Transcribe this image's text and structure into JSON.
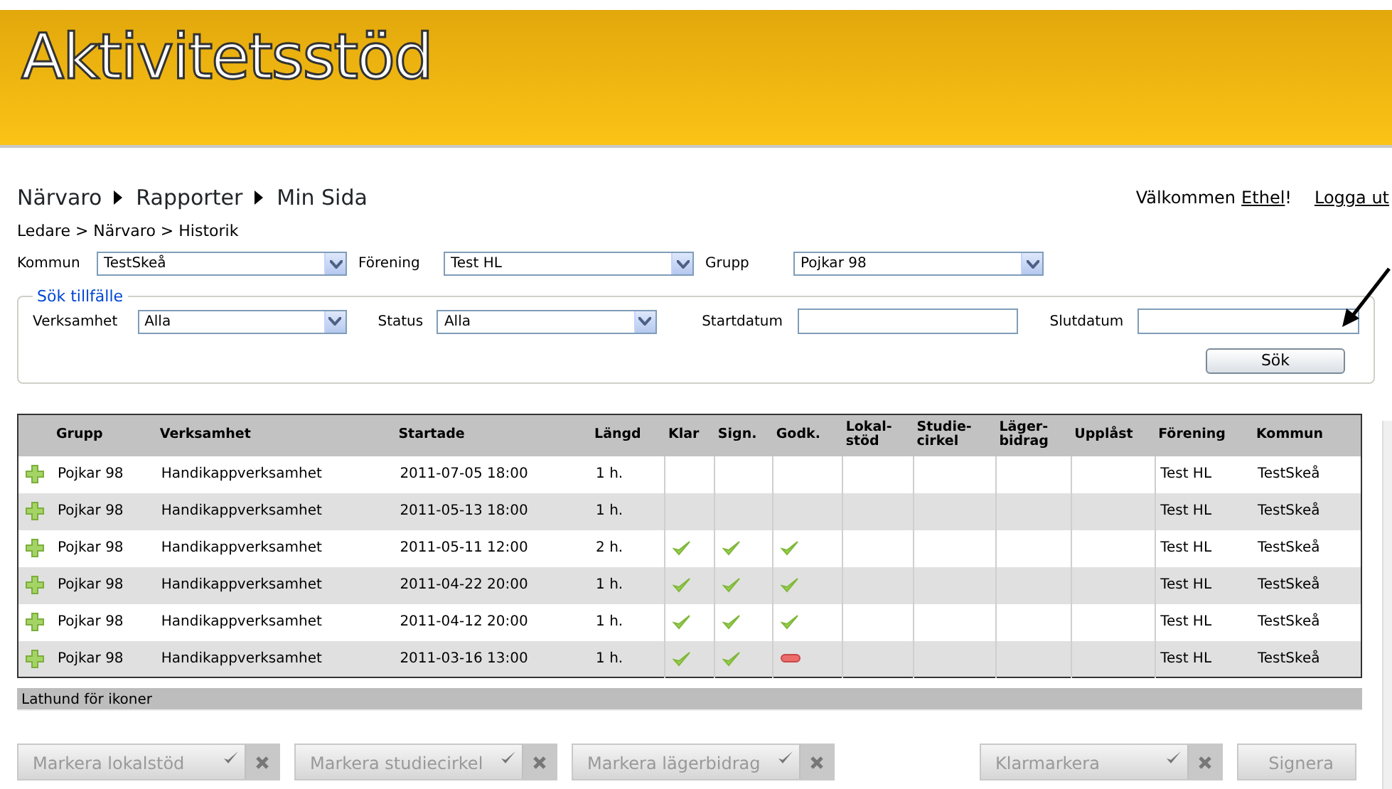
{
  "header": {
    "logo": "Aktivitetsstöd"
  },
  "nav": {
    "items": [
      "Närvaro",
      "Rapporter",
      "Min Sida"
    ],
    "welcome": "Välkommen",
    "user": "Ethel",
    "welcome_end": "!",
    "logout": "Logga ut"
  },
  "breadcrumb": "Ledare > Närvaro > Historik",
  "filters": [
    {
      "label": "Kommun",
      "value": "TestSkeå"
    },
    {
      "label": "Förening",
      "value": "Test HL"
    },
    {
      "label": "Grupp",
      "value": "Pojkar 98"
    }
  ],
  "search": {
    "legend": "Sök tillfälle",
    "fields": [
      {
        "kind": "select",
        "label": "Verksamhet",
        "value": "Alla"
      },
      {
        "kind": "select",
        "label": "Status",
        "value": "Alla"
      },
      {
        "kind": "text",
        "label": "Startdatum"
      },
      {
        "kind": "text",
        "label": "Slutdatum"
      }
    ],
    "button": "Sök"
  },
  "table": {
    "columns": [
      "Grupp",
      "Verksamhet",
      "Startade",
      "Längd",
      "Klar",
      "Sign.",
      "Godk.",
      "Lokal-\nstöd",
      "Studie-\ncirkel",
      "Läger-\nbidrag",
      "Upplåst",
      "Förening",
      "Kommun"
    ],
    "rows": [
      {
        "grupp": "Pojkar 98",
        "verksamhet": "Handikappverksamhet",
        "startade": "2011-07-05 18:00",
        "langd": "1 h.",
        "klar": false,
        "signerad": false,
        "godkand": false,
        "nekad": false,
        "forening": "Test HL",
        "kommun": "TestSkeå"
      },
      {
        "grupp": "Pojkar 98",
        "verksamhet": "Handikappverksamhet",
        "startade": "2011-05-13 18:00",
        "langd": "1 h.",
        "klar": false,
        "signerad": false,
        "godkand": false,
        "nekad": false,
        "forening": "Test HL",
        "kommun": "TestSkeå"
      },
      {
        "grupp": "Pojkar 98",
        "verksamhet": "Handikappverksamhet",
        "startade": "2011-05-11 12:00",
        "langd": "2 h.",
        "klar": true,
        "signerad": true,
        "godkand": true,
        "nekad": false,
        "forening": "Test HL",
        "kommun": "TestSkeå"
      },
      {
        "grupp": "Pojkar 98",
        "verksamhet": "Handikappverksamhet",
        "startade": "2011-04-22 20:00",
        "langd": "1 h.",
        "klar": true,
        "signerad": true,
        "godkand": true,
        "nekad": false,
        "forening": "Test HL",
        "kommun": "TestSkeå"
      },
      {
        "grupp": "Pojkar 98",
        "verksamhet": "Handikappverksamhet",
        "startade": "2011-04-12 20:00",
        "langd": "1 h.",
        "klar": true,
        "signerad": true,
        "godkand": true,
        "nekad": false,
        "forening": "Test HL",
        "kommun": "TestSkeå"
      },
      {
        "grupp": "Pojkar 98",
        "verksamhet": "Handikappverksamhet",
        "startade": "2011-03-16 13:00",
        "langd": "1 h.",
        "klar": true,
        "signerad": true,
        "godkand": false,
        "nekad": true,
        "forening": "Test HL",
        "kommun": "TestSkeå"
      }
    ]
  },
  "legend_bar": "Lathund för ikoner",
  "actions": [
    {
      "label": "Markera lokalstöd",
      "disabled": true,
      "confirm": true
    },
    {
      "label": "Markera studiecirkel",
      "disabled": true,
      "confirm": true
    },
    {
      "label": "Markera lägerbidrag",
      "disabled": true,
      "confirm": true
    },
    {
      "label": "Klarmarkera",
      "disabled": true,
      "confirm": true
    },
    {
      "label": "Signera",
      "disabled": true,
      "confirm": false
    }
  ]
}
